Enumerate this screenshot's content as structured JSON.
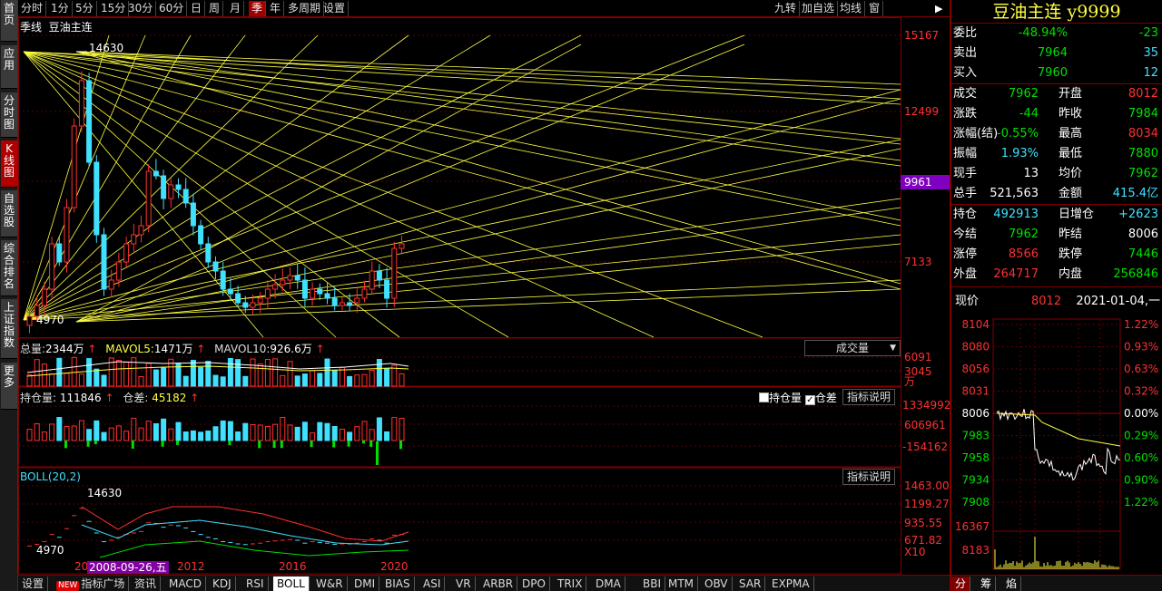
{
  "left_tabs": [
    "首页",
    "应用",
    "分时图",
    "K线图",
    "自选股",
    "综合排名",
    "上证指数",
    "更多"
  ],
  "top_periods": [
    "分时",
    "1分",
    "5分",
    "15分",
    "30分",
    "60分",
    "日",
    "周",
    "月",
    "季",
    "年",
    "多周期",
    "设置"
  ],
  "top_right_buttons": [
    "九转",
    "加自选",
    "均线",
    "窗"
  ],
  "chart_header": {
    "period": "季线",
    "name": "豆油主连"
  },
  "price_axis": [
    "15167",
    "12499",
    "9961",
    "7133"
  ],
  "price_labels": {
    "high": "14630",
    "low": "4970"
  },
  "volume": {
    "total_label": "总量:",
    "total": "2344万",
    "ma5_label": "MAVOL5:",
    "ma5": "1471万",
    "ma10_label": "MAVOL10:",
    "ma10": "926.6万",
    "select": "成交量",
    "axis": [
      "6091",
      "3045",
      "万"
    ]
  },
  "oi": {
    "label": "持仓量:",
    "value": "111846",
    "diff_label": "仓差:",
    "diff": "45182",
    "check1": "持仓量",
    "check2": "仓差",
    "help": "指标说明",
    "axis": [
      "1334992",
      "606961",
      "-154162"
    ]
  },
  "boll": {
    "label": "BOLL(20,2)",
    "help": "指标说明",
    "high": "14630",
    "low": "4970",
    "axis": [
      "1463.00",
      "1199.27",
      "935.55",
      "671.82",
      "X10"
    ]
  },
  "x_axis": {
    "years": [
      "2012",
      "2016",
      "2020"
    ],
    "partial_left": "20",
    "cursor_date": "2008-09-26,五"
  },
  "bottom_tabs": [
    "设置",
    "指标广场",
    "资讯",
    "MACD",
    "KDJ",
    "RSI",
    "BOLL",
    "W&R",
    "DMI",
    "BIAS",
    "ASI",
    "VR",
    "ARBR",
    "DPO",
    "TRIX",
    "DMA",
    "BBI",
    "MTM",
    "OBV",
    "SAR",
    "EXPMA"
  ],
  "new_badge": "NEW",
  "quote": {
    "title": "豆油主连 y9999",
    "rows": [
      [
        {
          "t": "委比",
          "c": "white"
        },
        {
          "t": "-48.94%",
          "c": "green"
        },
        {
          "t": "-23",
          "c": "green"
        }
      ],
      [
        {
          "t": "卖出",
          "c": "white"
        },
        {
          "t": "7964",
          "c": "green"
        },
        {
          "t": "35",
          "c": "cyan"
        }
      ],
      [
        {
          "t": "买入",
          "c": "white"
        },
        {
          "t": "7960",
          "c": "green"
        },
        {
          "t": "12",
          "c": "cyan"
        }
      ],
      [
        {
          "t": "成交",
          "c": "white"
        },
        {
          "t": "7962",
          "c": "green"
        },
        {
          "t": "开盘",
          "c": "white"
        },
        {
          "t": "8012",
          "c": "red"
        }
      ],
      [
        {
          "t": "涨跌",
          "c": "white"
        },
        {
          "t": "-44",
          "c": "green"
        },
        {
          "t": "昨收",
          "c": "white"
        },
        {
          "t": "7984",
          "c": "green"
        }
      ],
      [
        {
          "t": "涨幅(结)",
          "c": "white"
        },
        {
          "t": "-0.55%",
          "c": "green"
        },
        {
          "t": "最高",
          "c": "white"
        },
        {
          "t": "8034",
          "c": "red"
        }
      ],
      [
        {
          "t": "振幅",
          "c": "white"
        },
        {
          "t": "1.93%",
          "c": "cyan"
        },
        {
          "t": "最低",
          "c": "white"
        },
        {
          "t": "7880",
          "c": "green"
        }
      ],
      [
        {
          "t": "现手",
          "c": "white"
        },
        {
          "t": "13",
          "c": "white"
        },
        {
          "t": "均价",
          "c": "white"
        },
        {
          "t": "7962",
          "c": "green"
        }
      ],
      [
        {
          "t": "总手",
          "c": "white"
        },
        {
          "t": "521,563",
          "c": "white"
        },
        {
          "t": "金额",
          "c": "white"
        },
        {
          "t": "415.4亿",
          "c": "cyan"
        }
      ],
      [
        {
          "t": "持仓",
          "c": "white"
        },
        {
          "t": "492913",
          "c": "cyan"
        },
        {
          "t": "日增仓",
          "c": "white"
        },
        {
          "t": "+2623",
          "c": "cyan"
        }
      ],
      [
        {
          "t": "今结",
          "c": "white"
        },
        {
          "t": "7962",
          "c": "green"
        },
        {
          "t": "昨结",
          "c": "white"
        },
        {
          "t": "8006",
          "c": "white"
        }
      ],
      [
        {
          "t": "涨停",
          "c": "white"
        },
        {
          "t": "8566",
          "c": "red"
        },
        {
          "t": "跌停",
          "c": "white"
        },
        {
          "t": "7446",
          "c": "green"
        }
      ],
      [
        {
          "t": "外盘",
          "c": "white"
        },
        {
          "t": "264717",
          "c": "red"
        },
        {
          "t": "内盘",
          "c": "white"
        },
        {
          "t": "256846",
          "c": "green"
        }
      ]
    ],
    "current_label": "现价",
    "current_value": "8012",
    "date": "2021-01-04,一"
  },
  "intraday": {
    "left_axis": [
      "8104",
      "8080",
      "8056",
      "8031",
      "8006",
      "7983",
      "7958",
      "7934",
      "7908"
    ],
    "right_axis": [
      "1.22%",
      "0.93%",
      "0.63%",
      "0.32%",
      "0.00%",
      "0.29%",
      "0.60%",
      "0.90%",
      "1.22%"
    ],
    "vol_axis": [
      "16367",
      "8183"
    ]
  },
  "intraday_tabs": [
    "分",
    "筹",
    "焰"
  ],
  "colors": {
    "up": "#ff3030",
    "down": "#40e0ff",
    "fan": "#ffff40",
    "frame": "#800000"
  }
}
